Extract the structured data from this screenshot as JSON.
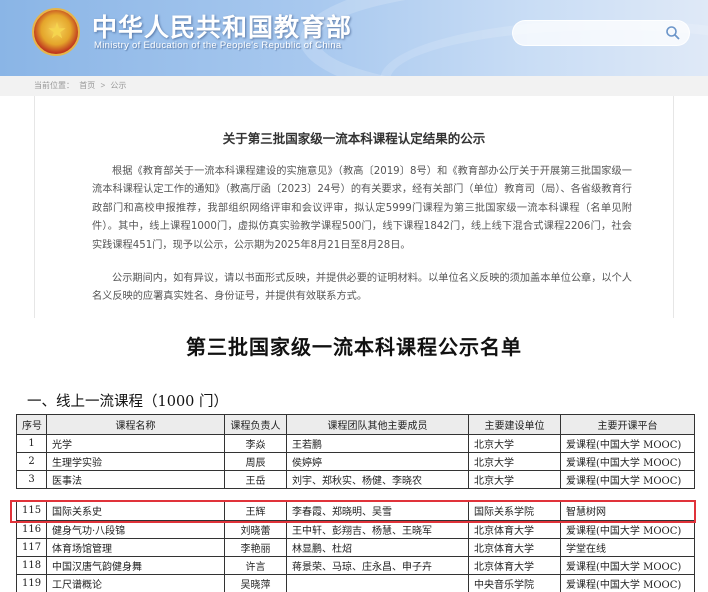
{
  "header": {
    "title": "中华人民共和国教育部",
    "subtitle": "Ministry of Education of the People's Republic of China"
  },
  "breadcrumb": [
    "当前位置：",
    "首页",
    ">",
    "公示"
  ],
  "notice": {
    "title": "关于第三批国家级一流本科课程认定结果的公示",
    "paragraph1": "根据《教育部关于一流本科课程建设的实施意见》（教高〔2019〕8号）和《教育部办公厅关于开展第三批国家级一流本科课程认定工作的通知》（教高厅函〔2023〕24号）的有关要求，经有关部门（单位）教育司（局）、各省级教育行政部门和高校申报推荐，我部组织网络评审和会议评审，拟认定5999门课程为第三批国家级一流本科课程（名单见附件）。其中，线上课程1000门，虚拟仿真实验教学课程500门，线下课程1842门，线上线下混合式课程2206门，社会实践课程451门，现予以公示，公示期为2025年8月21日至8月28日。",
    "paragraph2": "公示期间内，如有异议，请以书面形式反映，并提供必要的证明材料。以单位名义反映的须加盖本单位公章，以个人名义反映的应署真实姓名、身份证号，并提供有效联系方式。"
  },
  "list": {
    "title": "第三批国家级一流本科课程公示名单",
    "section_heading": "一、线上一流课程（1000 门）"
  },
  "table": {
    "columns": [
      "序号",
      "课程名称",
      "课程负责人",
      "课程团队其他主要成员",
      "主要建设单位",
      "主要开课平台"
    ],
    "rows_top": [
      [
        "1",
        "光学",
        "李焱",
        "王若鹏",
        "北京大学",
        "爱课程(中国大学 MOOC)"
      ],
      [
        "2",
        "生理学实验",
        "周辰",
        "侯婷婷",
        "北京大学",
        "爱课程(中国大学 MOOC)"
      ],
      [
        "3",
        "医事法",
        "王岳",
        "刘宇、郑秋实、杨健、李晓农",
        "北京大学",
        "爱课程(中国大学 MOOC)"
      ]
    ],
    "highlight_row": [
      "115",
      "国际关系史",
      "王辉",
      "李春霞、郑晓明、吴雪",
      "国际关系学院",
      "智慧树网"
    ],
    "rows_bottom": [
      [
        "116",
        "健身气功·八段锦",
        "刘晓蕾",
        "王中轩、彭翔吉、杨慧、王晓军",
        "北京体育大学",
        "爱课程(中国大学 MOOC)"
      ],
      [
        "117",
        "体育场馆管理",
        "李艳丽",
        "林显鹏、杜炤",
        "北京体育大学",
        "学堂在线"
      ],
      [
        "118",
        "中国汉唐气韵健身舞",
        "许言",
        "蒋景荣、马琼、庄永昌、申子卉",
        "北京体育大学",
        "爱课程(中国大学 MOOC)"
      ],
      [
        "119",
        "工尺谱概论",
        "吴晓萍",
        "",
        "中央音乐学院",
        "爱课程(中国大学 MOOC)"
      ]
    ]
  },
  "colors": {
    "banner": "#8ab5e6",
    "highlight_border": "#e0333a",
    "table_header_bg": "#ececec"
  },
  "icons": {
    "emblem": "national-emblem-icon",
    "search": "search-icon"
  }
}
